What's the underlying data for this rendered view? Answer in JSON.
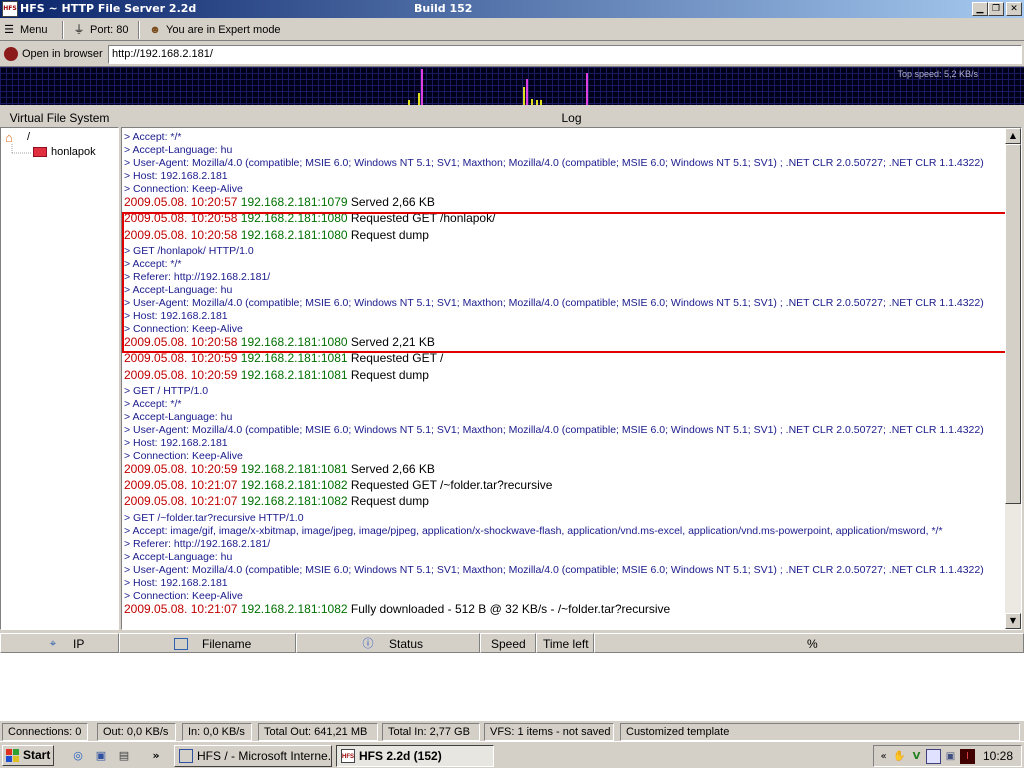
{
  "window": {
    "title": "HFS ~ HTTP File Server 2.2d",
    "build": "Build 152",
    "app_icon_text": "HFS"
  },
  "toolbar": {
    "menu_label": "Menu",
    "port_label": "Port: 80",
    "mode_label": "You are in Expert mode"
  },
  "urlbar": {
    "open_label": "Open in browser",
    "url": "http://192.168.2.181/"
  },
  "graph": {
    "top_speed": "Top speed: 5,2 KB/s"
  },
  "vfs": {
    "header": "Virtual File System",
    "root": "/",
    "folder": "honlapok"
  },
  "log": {
    "header": "Log",
    "lines": [
      {
        "kind": "dump",
        "text": "> Accept: */*"
      },
      {
        "kind": "dump",
        "text": "> Accept-Language: hu"
      },
      {
        "kind": "dump",
        "text": "> User-Agent: Mozilla/4.0 (compatible; MSIE 6.0; Windows NT 5.1; SV1; Maxthon; Mozilla/4.0 (compatible; MSIE 6.0; Windows NT 5.1; SV1) ; .NET CLR 2.0.50727; .NET CLR 1.1.4322)"
      },
      {
        "kind": "dump",
        "text": "> Host: 192.168.2.181"
      },
      {
        "kind": "dump",
        "text": "> Connection: Keep-Alive"
      },
      {
        "kind": "evt",
        "ts": "2009.05.08. 10:20:57",
        "addr": "192.168.2.181:1079",
        "text": "Served 2,66 KB"
      },
      {
        "kind": "evt",
        "ts": "2009.05.08. 10:20:58",
        "addr": "192.168.2.181:1080",
        "text": "Requested GET /honlapok/"
      },
      {
        "kind": "evt",
        "ts": "2009.05.08. 10:20:58",
        "addr": "192.168.2.181:1080",
        "text": "Request dump"
      },
      {
        "kind": "dump",
        "text": "> GET /honlapok/ HTTP/1.0"
      },
      {
        "kind": "dump",
        "text": "> Accept: */*"
      },
      {
        "kind": "dump",
        "text": "> Referer: http://192.168.2.181/"
      },
      {
        "kind": "dump",
        "text": "> Accept-Language: hu"
      },
      {
        "kind": "dump",
        "text": "> User-Agent: Mozilla/4.0 (compatible; MSIE 6.0; Windows NT 5.1; SV1; Maxthon; Mozilla/4.0 (compatible; MSIE 6.0; Windows NT 5.1; SV1) ; .NET CLR 2.0.50727; .NET CLR 1.1.4322)"
      },
      {
        "kind": "dump",
        "text": "> Host: 192.168.2.181"
      },
      {
        "kind": "dump",
        "text": "> Connection: Keep-Alive"
      },
      {
        "kind": "evt",
        "ts": "2009.05.08. 10:20:58",
        "addr": "192.168.2.181:1080",
        "text": "Served 2,21 KB"
      },
      {
        "kind": "evt",
        "ts": "2009.05.08. 10:20:59",
        "addr": "192.168.2.181:1081",
        "text": "Requested GET /"
      },
      {
        "kind": "evt",
        "ts": "2009.05.08. 10:20:59",
        "addr": "192.168.2.181:1081",
        "text": "Request dump"
      },
      {
        "kind": "dump",
        "text": "> GET / HTTP/1.0"
      },
      {
        "kind": "dump",
        "text": "> Accept: */*"
      },
      {
        "kind": "dump",
        "text": "> Accept-Language: hu"
      },
      {
        "kind": "dump",
        "text": "> User-Agent: Mozilla/4.0 (compatible; MSIE 6.0; Windows NT 5.1; SV1; Maxthon; Mozilla/4.0 (compatible; MSIE 6.0; Windows NT 5.1; SV1) ; .NET CLR 2.0.50727; .NET CLR 1.1.4322)"
      },
      {
        "kind": "dump",
        "text": "> Host: 192.168.2.181"
      },
      {
        "kind": "dump",
        "text": "> Connection: Keep-Alive"
      },
      {
        "kind": "evt",
        "ts": "2009.05.08. 10:20:59",
        "addr": "192.168.2.181:1081",
        "text": "Served 2,66 KB"
      },
      {
        "kind": "evt",
        "ts": "2009.05.08. 10:21:07",
        "addr": "192.168.2.181:1082",
        "text": "Requested GET /~folder.tar?recursive"
      },
      {
        "kind": "evt",
        "ts": "2009.05.08. 10:21:07",
        "addr": "192.168.2.181:1082",
        "text": "Request dump"
      },
      {
        "kind": "dump",
        "text": "> GET /~folder.tar?recursive HTTP/1.0"
      },
      {
        "kind": "dump",
        "text": "> Accept: image/gif, image/x-xbitmap, image/jpeg, image/pjpeg, application/x-shockwave-flash, application/vnd.ms-excel, application/vnd.ms-powerpoint, application/msword, */*"
      },
      {
        "kind": "dump",
        "text": "> Referer: http://192.168.2.181/"
      },
      {
        "kind": "dump",
        "text": "> Accept-Language: hu"
      },
      {
        "kind": "dump",
        "text": "> User-Agent: Mozilla/4.0 (compatible; MSIE 6.0; Windows NT 5.1; SV1; Maxthon; Mozilla/4.0 (compatible; MSIE 6.0; Windows NT 5.1; SV1) ; .NET CLR 2.0.50727; .NET CLR 1.1.4322)"
      },
      {
        "kind": "dump",
        "text": "> Host: 192.168.2.181"
      },
      {
        "kind": "dump",
        "text": "> Connection: Keep-Alive"
      },
      {
        "kind": "evt",
        "ts": "2009.05.08. 10:21:07",
        "addr": "192.168.2.181:1082",
        "text": "Fully downloaded - 512 B @ 32 KB/s - /~folder.tar?recursive"
      }
    ]
  },
  "connections": {
    "columns": [
      "IP",
      "Filename",
      "Status",
      "Speed",
      "Time left",
      "%"
    ]
  },
  "statusbar": {
    "connections": "Connections: 0",
    "out": "Out: 0,0 KB/s",
    "in": "In: 0,0 KB/s",
    "total_out": "Total Out: 641,21 MB",
    "total_in": "Total In: 2,77 GB",
    "vfs": "VFS: 1 items - not saved",
    "template": "Customized template"
  },
  "taskbar": {
    "start": "Start",
    "tasks": [
      "HFS / - Microsoft Interne...",
      "HFS 2.2d (152)"
    ],
    "clock": "10:28",
    "chevron": "»"
  },
  "colors": {
    "timestamp": "#c00000",
    "address": "#007000",
    "dump": "#1a1a8c",
    "highlight": "#e00000"
  }
}
